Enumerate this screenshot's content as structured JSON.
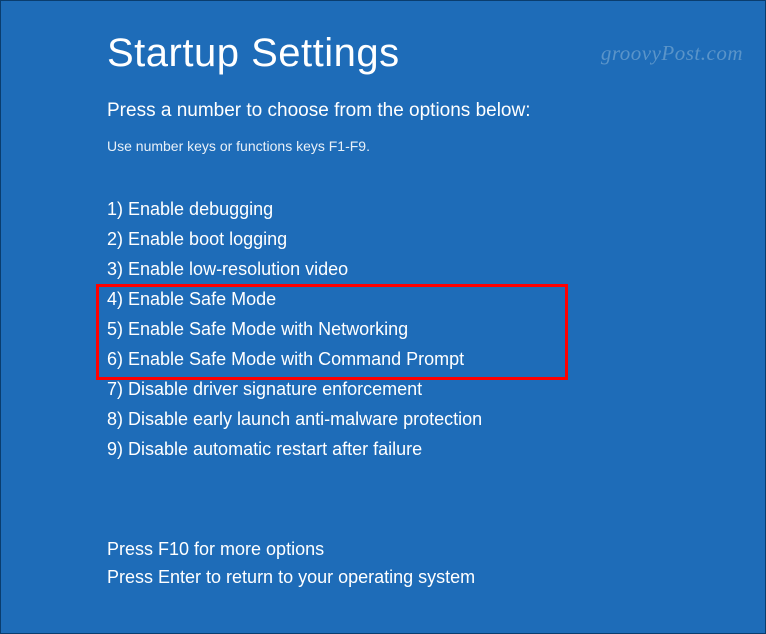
{
  "title": "Startup Settings",
  "subtitle": "Press a number to choose from the options below:",
  "hint": "Use number keys or functions keys F1-F9.",
  "options": [
    "1) Enable debugging",
    "2) Enable boot logging",
    "3) Enable low-resolution video",
    "4) Enable Safe Mode",
    "5) Enable Safe Mode with Networking",
    "6) Enable Safe Mode with Command Prompt",
    "7) Disable driver signature enforcement",
    "8) Disable early launch anti-malware protection",
    "9) Disable automatic restart after failure"
  ],
  "footer": {
    "more_options": "Press F10 for more options",
    "return": "Press Enter to return to your operating system"
  },
  "watermark": "groovyPost.com"
}
